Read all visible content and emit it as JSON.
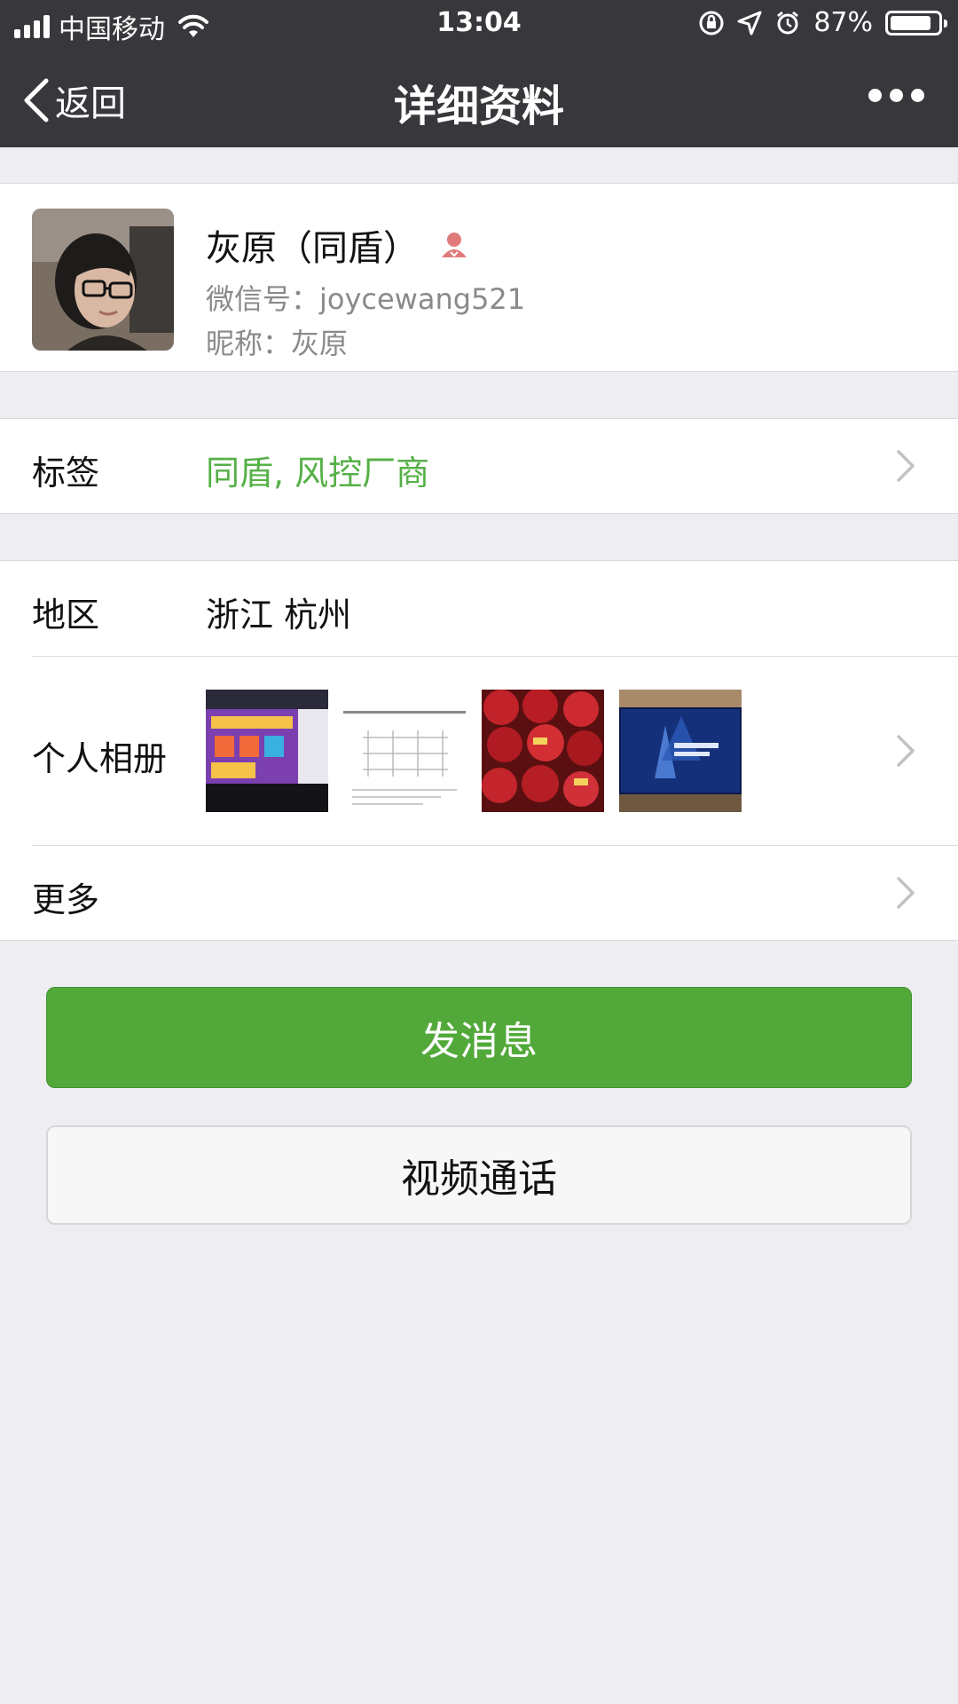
{
  "status_bar": {
    "carrier": "中国移动",
    "time": "13:04",
    "battery": "87%",
    "battery_level": 0.87
  },
  "nav": {
    "back_label": "返回",
    "title": "详细资料",
    "more_icon": "ellipsis-icon"
  },
  "profile": {
    "name": "灰原（同盾）",
    "gender_icon": "female-icon",
    "wechat_id": "微信号：joycewang521",
    "nickname": "昵称：灰原"
  },
  "tags": {
    "label": "标签",
    "value": "同盾, 风控厂商",
    "value_color": "#56b048"
  },
  "region": {
    "label": "地区",
    "value": "浙江 杭州"
  },
  "album": {
    "label": "个人相册",
    "photos": [
      "photo-1",
      "photo-2",
      "photo-3",
      "photo-4"
    ]
  },
  "more": {
    "label": "更多"
  },
  "actions": {
    "send_message": "发消息",
    "video_call": "视频通话",
    "primary_color": "#52a93a"
  }
}
